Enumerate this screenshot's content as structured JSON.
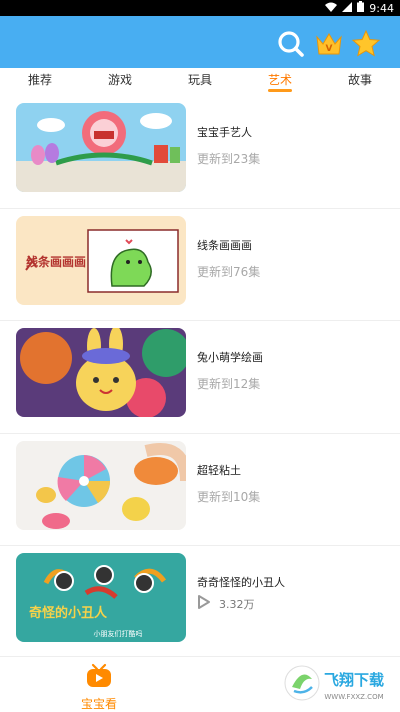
{
  "status_bar": {
    "time": "9:44"
  },
  "header": {
    "icons": [
      "search-icon",
      "crown-icon",
      "star-icon"
    ]
  },
  "tabs": [
    {
      "label": "推荐",
      "active": false
    },
    {
      "label": "游戏",
      "active": false
    },
    {
      "label": "玩具",
      "active": false
    },
    {
      "label": "艺术",
      "active": true
    },
    {
      "label": "故事",
      "active": false
    }
  ],
  "items": [
    {
      "title": "宝宝手艺人",
      "subtitle": "更新到23集"
    },
    {
      "title": "线条画画画",
      "subtitle": "更新到76集",
      "thumb_text": "线条画画画"
    },
    {
      "title": "兔小萌学绘画",
      "subtitle": "更新到12集"
    },
    {
      "title": "超轻粘土",
      "subtitle": "更新到10集"
    },
    {
      "title": "奇奇怪怪的小丑人",
      "plays": "3.32万",
      "thumb_text": "奇怪的小丑人",
      "thumb_sub": "小朋友们打酷吗"
    }
  ],
  "bottom_nav": {
    "label": "宝宝看"
  },
  "watermark": {
    "text": "飞翔下载",
    "url_text": "WWW.FXXZ.COM"
  },
  "colors": {
    "header": "#48aef2",
    "accent": "#ff8a00"
  }
}
